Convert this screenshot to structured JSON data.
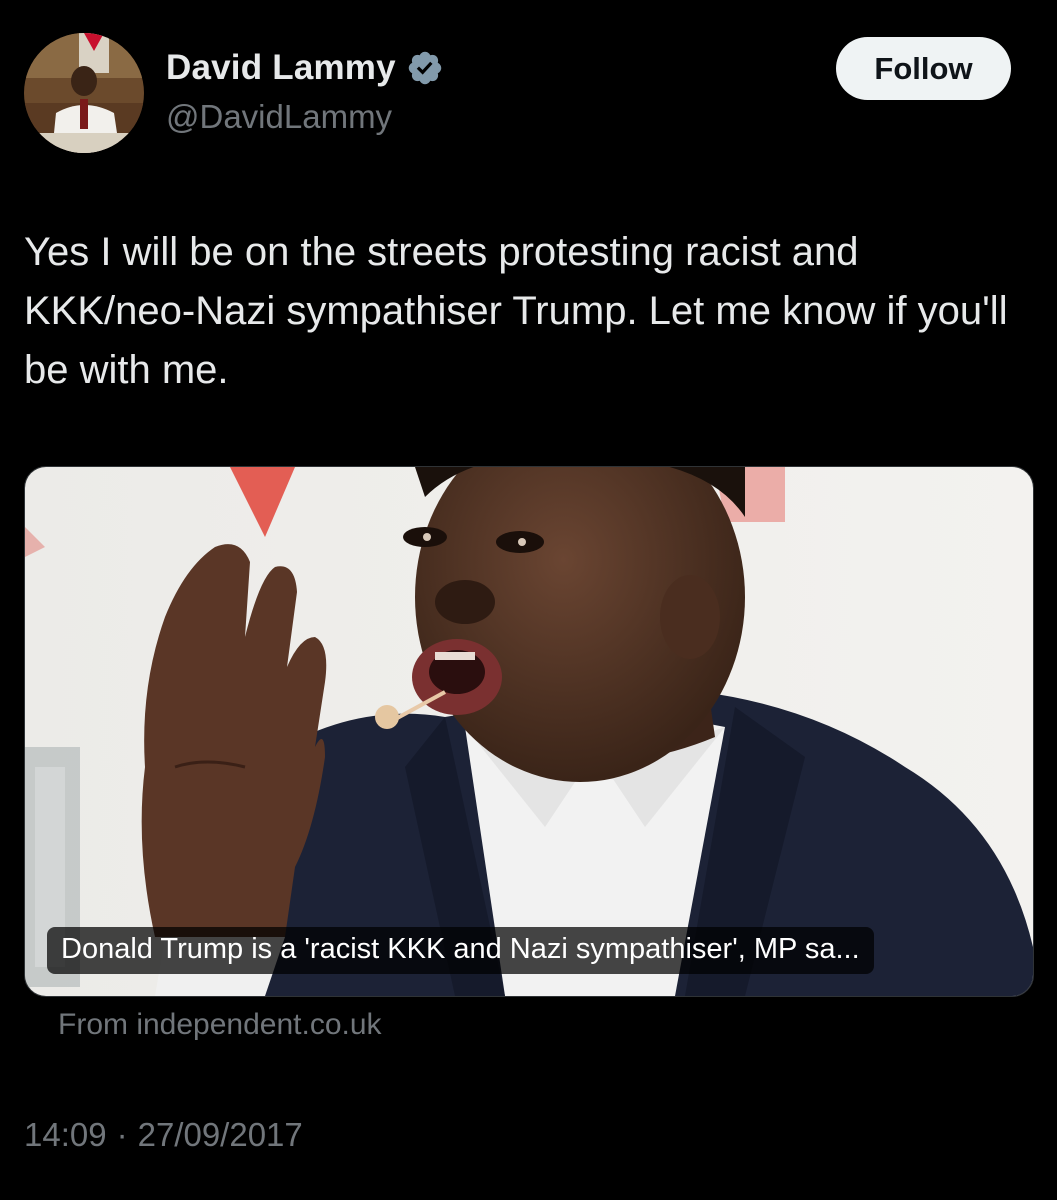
{
  "author": {
    "display_name": "David Lammy",
    "handle": "@DavidLammy",
    "verified": true
  },
  "follow_button": {
    "label": "Follow"
  },
  "tweet": {
    "text": "Yes I will be on the streets protesting racist and KKK/neo-Nazi sympathiser Trump. Let me know if you'll be with me."
  },
  "link_card": {
    "caption": "Donald Trump is a 'racist KKK and Nazi sympathiser', MP sa...",
    "source": "From independent.co.uk"
  },
  "meta": {
    "time": "14:09",
    "separator": "·",
    "date": "27/09/2017"
  },
  "colors": {
    "background": "#000000",
    "text_primary": "#e7e9ea",
    "text_secondary": "#71767b",
    "verified_badge": "#829aab",
    "follow_button_bg": "#eff3f4"
  }
}
